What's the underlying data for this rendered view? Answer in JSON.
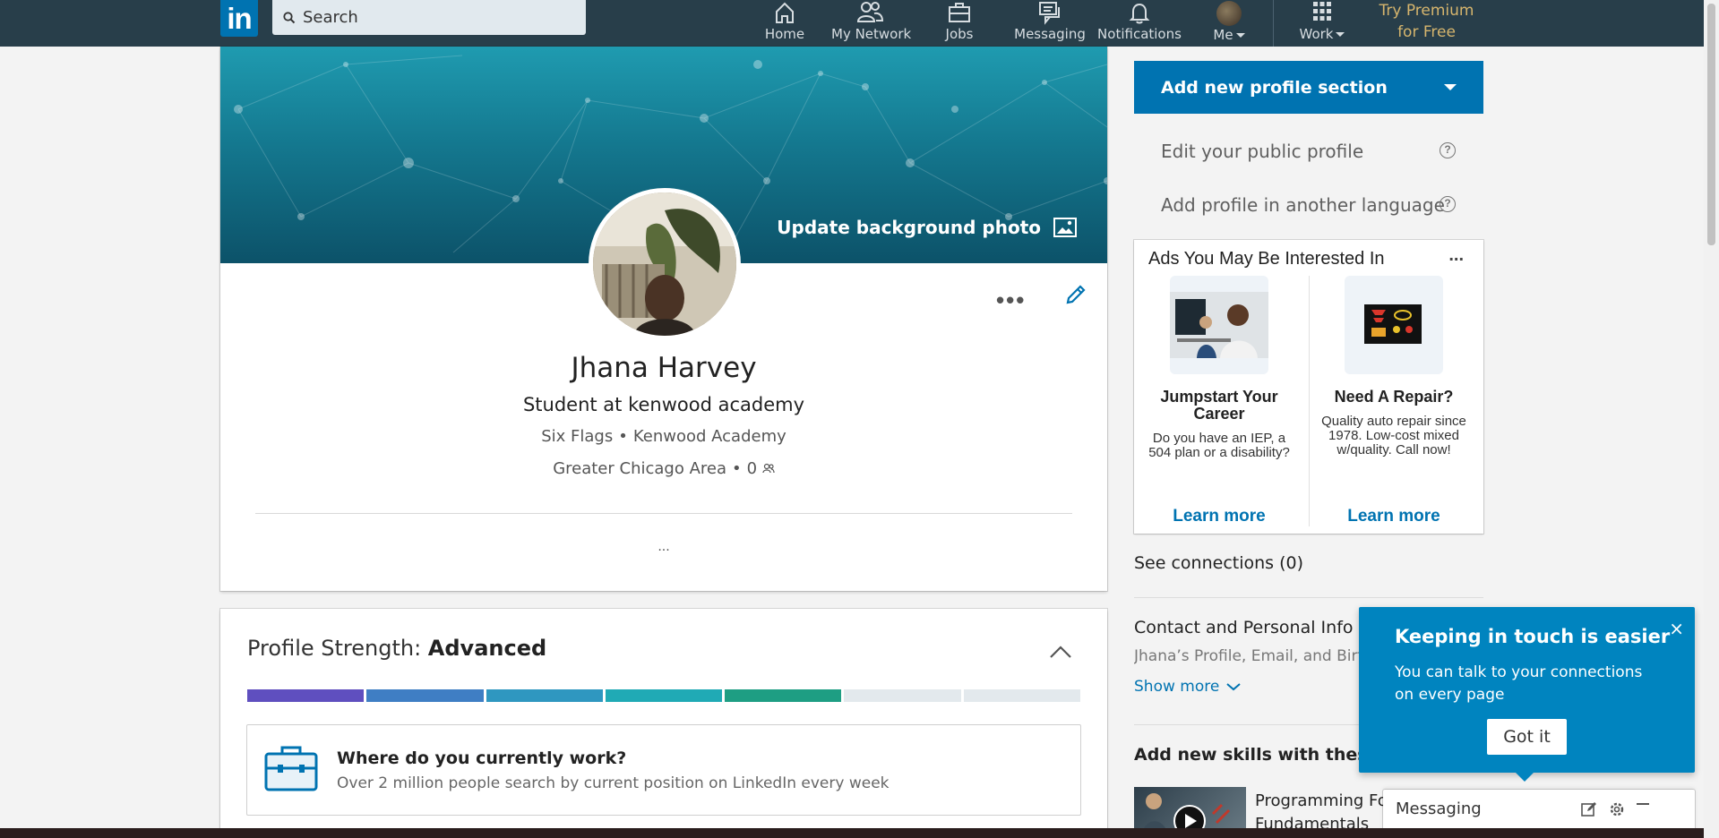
{
  "colors": {
    "nav_bg": "#283e4a",
    "brand_blue": "#0073b1",
    "premium_gold": "#d6b56d",
    "tooltip_blue": "#0084bf"
  },
  "nav": {
    "logo_text": "in",
    "search_placeholder": "Search",
    "items": [
      {
        "label": "Home",
        "icon": "home-icon"
      },
      {
        "label": "My Network",
        "icon": "network-icon"
      },
      {
        "label": "Jobs",
        "icon": "briefcase-icon"
      },
      {
        "label": "Messaging",
        "icon": "messaging-icon"
      },
      {
        "label": "Notifications",
        "icon": "bell-icon"
      },
      {
        "label": "Me",
        "icon": "avatar"
      },
      {
        "label": "Work",
        "icon": "grid-icon"
      }
    ],
    "premium_line1": "Try Premium",
    "premium_line2": "for Free"
  },
  "profile": {
    "update_background": "Update background photo",
    "name": "Jhana Harvey",
    "headline": "Student at kenwood academy",
    "company": "Six Flags",
    "school": "Kenwood Academy",
    "location": "Greater Chicago Area",
    "connections_count": "0",
    "more": "..."
  },
  "strength": {
    "label": "Profile Strength:",
    "level": "Advanced",
    "filled_segments": 5,
    "total_segments": 7,
    "segment_colors": [
      "#5f4fbf",
      "#3f7ec4",
      "#2f97c0",
      "#20aab5",
      "#1e9e83",
      "#e3e9ed",
      "#e3e9ed"
    ],
    "prompt_title": "Where do you currently work?",
    "prompt_sub": "Over 2 million people search by current position on LinkedIn every week"
  },
  "rail": {
    "add_section": "Add new profile section",
    "edit_public": "Edit your public profile",
    "add_language": "Add profile in another language",
    "ads_title": "Ads You May Be Interested In",
    "ads_more": "...",
    "ads": [
      {
        "title": "Jumpstart Your Career",
        "desc": "Do you have an IEP, a 504 plan or a disability?",
        "cta": "Learn more"
      },
      {
        "title": "Need A Repair?",
        "desc": "Quality auto repair since 1978. Low-cost mixed w/quality. Call now!",
        "cta": "Learn more"
      }
    ],
    "see_connections": "See connections (0)",
    "contact_title": "Contact and Personal Info",
    "contact_sub": "Jhana’s Profile, Email, and Birt",
    "show_more": "Show more",
    "skills_title": "Add new skills with these co",
    "course_title": "Programming Fou Fundamentals"
  },
  "tooltip": {
    "title": "Keeping in touch is easier",
    "body": "You can talk to your connections on every page",
    "button": "Got it",
    "close": "×"
  },
  "messaging": {
    "title": "Messaging"
  }
}
